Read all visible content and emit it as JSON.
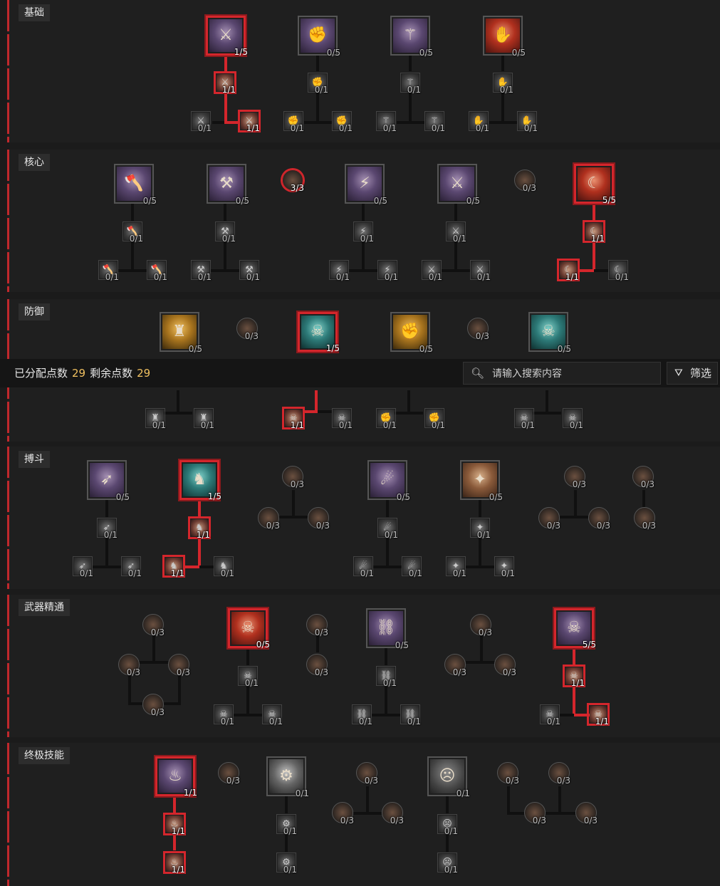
{
  "sections": {
    "basic": {
      "title": "基础"
    },
    "core": {
      "title": "核心"
    },
    "defense": {
      "title": "防御"
    },
    "brawl": {
      "title": "搏斗"
    },
    "weapon": {
      "title": "武器精通"
    },
    "ultimate": {
      "title": "终极技能"
    }
  },
  "toolbar": {
    "allocated_label": "已分配点数",
    "allocated_value": "29",
    "remaining_label": "剩余点数",
    "remaining_value": "29",
    "search_placeholder": "请输入搜索内容",
    "filter_label": "筛选",
    "search_icon": "search-icon",
    "filter_icon": "filter-icon"
  },
  "counts": {
    "b1": "1/5",
    "b2": "0/5",
    "b3": "0/5",
    "b4": "0/5",
    "b1a": "1/1",
    "b1l": "0/1",
    "b1r": "1/1",
    "b2a": "0/1",
    "b2l": "0/1",
    "b2r": "0/1",
    "b3a": "0/1",
    "b3l": "0/1",
    "b3r": "0/1",
    "b4a": "0/1",
    "b4l": "0/1",
    "b4r": "0/1",
    "c1": "0/5",
    "c2": "0/5",
    "cp1": "3/3",
    "c3": "0/5",
    "c4": "0/5",
    "cp2": "0/3",
    "c5": "5/5",
    "c1a": "0/1",
    "c1l": "0/1",
    "c1r": "0/1",
    "c2a": "0/1",
    "c2l": "0/1",
    "c2r": "0/1",
    "c3a": "0/1",
    "c3l": "0/1",
    "c3r": "0/1",
    "c4a": "0/1",
    "c4l": "0/1",
    "c4r": "0/1",
    "c5a": "1/1",
    "c5l": "1/1",
    "c5r": "0/1",
    "d1": "0/5",
    "dp1": "0/3",
    "d2": "1/5",
    "d3": "0/5",
    "dp2": "0/3",
    "d4": "0/5",
    "d1l": "0/1",
    "d1r": "0/1",
    "d2l": "1/1",
    "d2r": "0/1",
    "d3l": "0/1",
    "d3r": "0/1",
    "d4l": "0/1",
    "d4r": "0/1",
    "r1": "0/5",
    "r2": "1/5",
    "rp1": "0/3",
    "r3": "0/5",
    "r4": "0/5",
    "rp2": "0/3",
    "rp3": "0/3",
    "r1a": "0/1",
    "r1l": "0/1",
    "r1r": "0/1",
    "r2a": "1/1",
    "r2l": "1/1",
    "r2r": "0/1",
    "rp1l": "0/3",
    "rp1r": "0/3",
    "r3a": "0/1",
    "r3l": "0/1",
    "r3r": "0/1",
    "r4a": "0/1",
    "r4l": "0/1",
    "r4r": "0/1",
    "rp2l": "0/3",
    "rp2r": "0/3",
    "rp3a": "0/3",
    "wp1": "0/3",
    "w1": "0/5",
    "wp2": "0/3",
    "w2": "0/5",
    "wp3": "0/3",
    "w3": "5/5",
    "wp1l": "0/3",
    "wp1r": "0/3",
    "wp1b": "0/3",
    "w1a": "0/1",
    "w1l": "0/1",
    "w1r": "0/1",
    "wp2a": "0/3",
    "w2a": "0/1",
    "w2l": "0/1",
    "w2r": "0/1",
    "wp3l": "0/3",
    "wp3r": "0/3",
    "w3a": "1/1",
    "w3l": "0/1",
    "w3r": "1/1",
    "u1": "1/1",
    "up1": "0/3",
    "u2": "0/1",
    "up2": "0/3",
    "u3": "0/1",
    "up3": "0/3",
    "up4": "0/3",
    "u1a": "1/1",
    "u1b": "1/1",
    "u2a": "0/1",
    "u2b": "0/1",
    "up2l": "0/3",
    "up2r": "0/3",
    "u3a": "0/1",
    "u3b": "0/1",
    "up34l": "0/3",
    "up34r": "0/3"
  },
  "colors": {
    "accent_red": "#d4262c",
    "points_value": "#f0c060"
  }
}
